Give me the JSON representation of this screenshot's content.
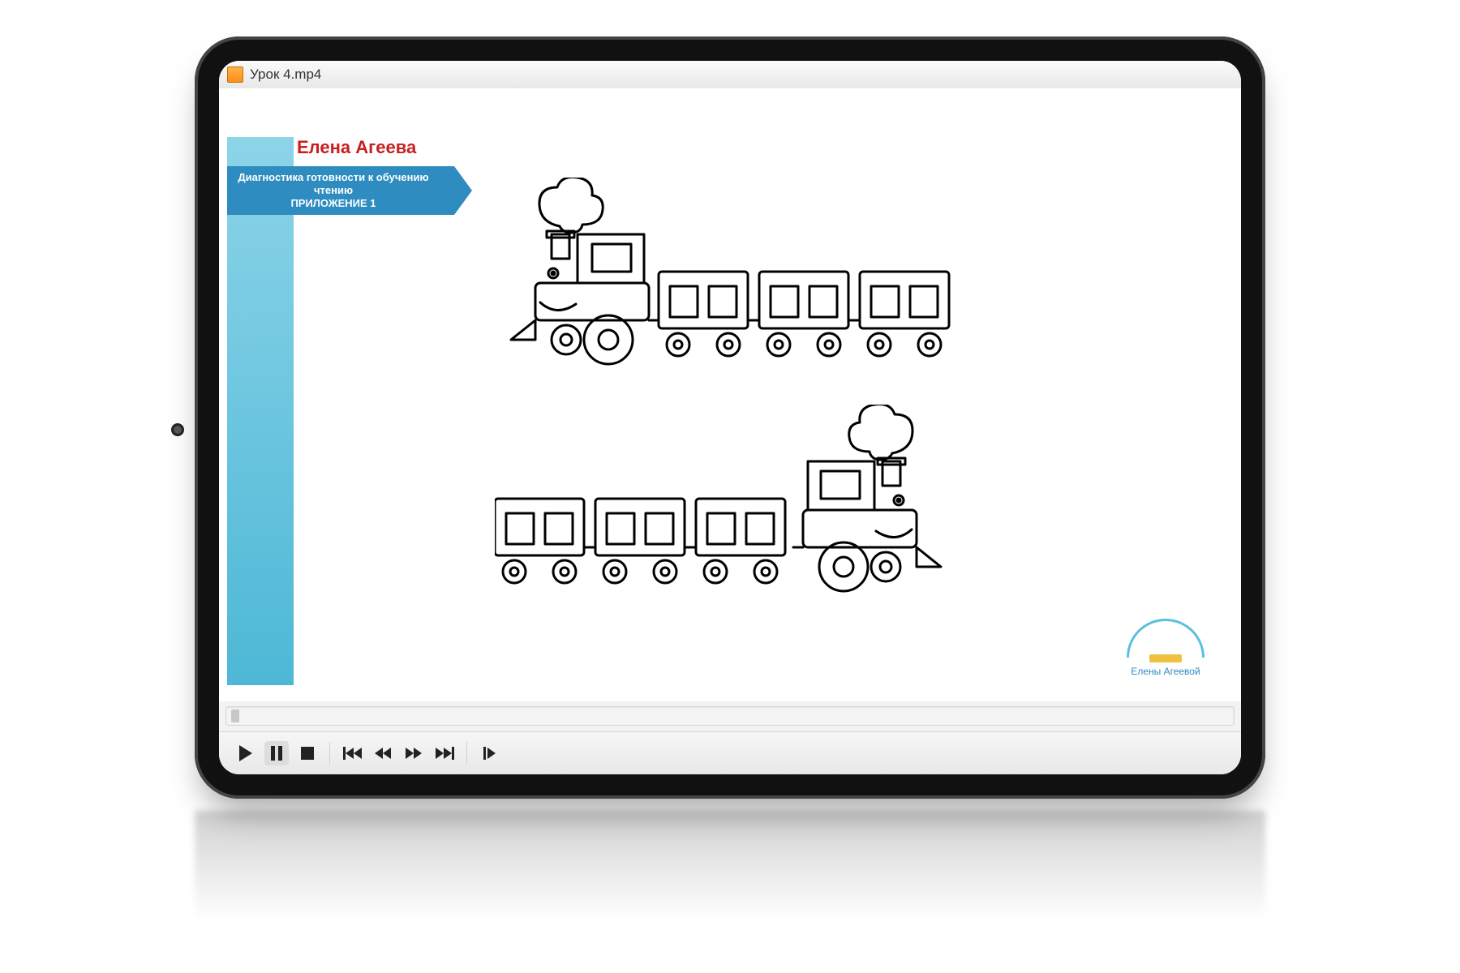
{
  "titlebar": {
    "filename": "Урок 4.mp4"
  },
  "slide": {
    "author": "Елена Агеева",
    "subtitle_line1": "Диагностика готовности к обучению чтению",
    "subtitle_line2": "ПРИЛОЖЕНИЕ 1",
    "brand_caption": "Елены Агеевой"
  },
  "player": {
    "buttons": {
      "play": "Play",
      "pause": "Pause",
      "stop": "Stop",
      "prev_track": "Previous",
      "rewind": "Rewind",
      "fast_forward": "Fast forward",
      "next_track": "Next",
      "frame_step": "Frame step"
    },
    "active_button": "pause"
  },
  "colors": {
    "accent_red": "#c81e1e",
    "ribbon_blue": "#2e8cc0",
    "stripe_blue": "#4db8d6"
  }
}
